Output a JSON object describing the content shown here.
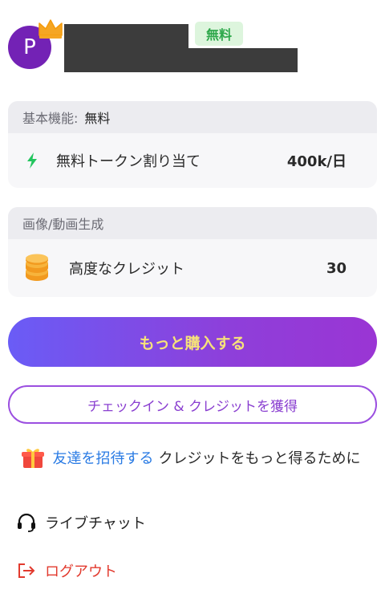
{
  "profile": {
    "avatar_letter": "P",
    "plan_badge": "無料"
  },
  "basic": {
    "header_label": "基本機能:",
    "header_value": "無料",
    "row_label": "無料トークン割り当て",
    "row_value": "400k/日"
  },
  "generation": {
    "header_label": "画像/動画生成",
    "row_label": "高度なクレジット",
    "row_value": "30"
  },
  "actions": {
    "buy_label": "もっと購入する",
    "checkin_label": "チェックイン & クレジットを獲得"
  },
  "invite": {
    "link_text": "友達を招待する",
    "suffix_text": "クレジットをもっと得るために"
  },
  "menu": {
    "live_chat": "ライブチャット",
    "logout": "ログアウト"
  },
  "colors": {
    "avatar": "#7322b5",
    "plan_badge_bg": "#ddf5dd",
    "plan_badge_text": "#2ea84b",
    "buy_gradient_start": "#6a5cf6",
    "buy_gradient_end": "#9a35d4",
    "buy_text": "#f6e27a",
    "checkin_border": "#9b4fe0",
    "link": "#2a7be4",
    "logout": "#e23a2e",
    "bolt": "#22c55e",
    "coin": "#f5a623"
  },
  "icons": [
    "crown-icon",
    "bolt-icon",
    "coins-icon",
    "gift-icon",
    "headset-icon",
    "logout-icon"
  ]
}
